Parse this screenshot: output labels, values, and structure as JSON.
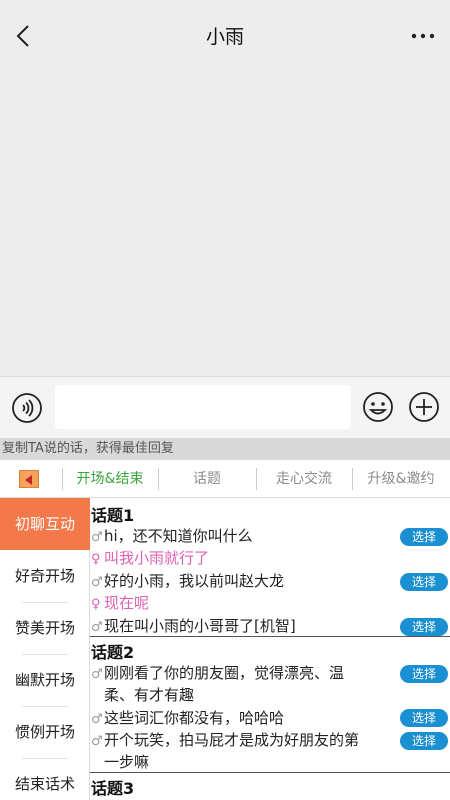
{
  "header": {
    "title": "小雨"
  },
  "input": {
    "value": ""
  },
  "tip": "复制TA说的话，获得最佳回复",
  "tabs": [
    "开场&结束",
    "话题",
    "走心交流",
    "升级&邀约"
  ],
  "categories": [
    "初聊互动",
    "好奇开场",
    "赞美开场",
    "幽默开场",
    "惯例开场",
    "结束话术"
  ],
  "select_label": "选择",
  "male_symbol": "♂",
  "female_symbol": "♀",
  "topics": [
    {
      "title": "话题1",
      "lines": [
        "hi，还不知道你叫什么",
        "叫我小雨就行了",
        "好的小雨，我以前叫赵大龙",
        "现在呢",
        "现在叫小雨的小哥哥了[机智]"
      ]
    },
    {
      "title": "话题2",
      "lines": [
        "刚刚看了你的朋友圈，觉得漂亮、温",
        "柔、有才有趣",
        "这些词汇你都没有，哈哈哈",
        "开个玩笑，拍马屁才是成为好朋友的第",
        "一步嘛"
      ]
    },
    {
      "title": "话题3"
    }
  ],
  "colors": {
    "accent_green": "#3aa53a",
    "category_active": "#f3784a",
    "select_blue": "#1a8fd1",
    "female_pink": "#e060b4"
  }
}
